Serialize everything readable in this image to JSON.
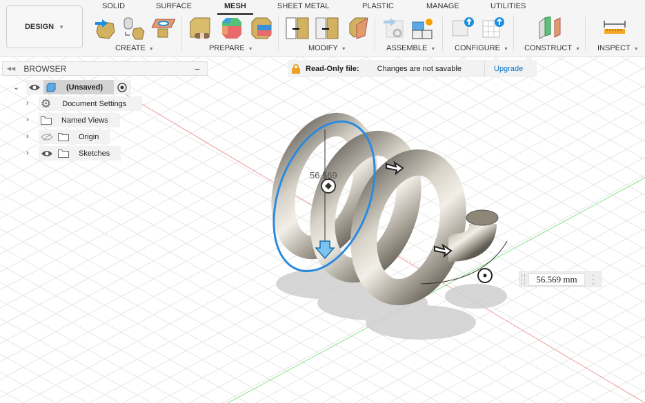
{
  "workspace": {
    "label": "DESIGN"
  },
  "tabs": [
    {
      "label": "SOLID"
    },
    {
      "label": "SURFACE"
    },
    {
      "label": "MESH",
      "active": true
    },
    {
      "label": "SHEET METAL"
    },
    {
      "label": "PLASTIC"
    },
    {
      "label": "MANAGE"
    },
    {
      "label": "UTILITIES"
    }
  ],
  "groups": [
    {
      "label": "CREATE"
    },
    {
      "label": "PREPARE"
    },
    {
      "label": "MODIFY"
    },
    {
      "label": "ASSEMBLE"
    },
    {
      "label": "CONFIGURE"
    },
    {
      "label": "CONSTRUCT"
    },
    {
      "label": "INSPECT"
    }
  ],
  "browser": {
    "title": "BROWSER",
    "root": "(Unsaved)",
    "items": [
      {
        "label": "Document Settings",
        "icon": "gear-icon"
      },
      {
        "label": "Named Views",
        "icon": "folder-icon"
      },
      {
        "label": "Origin",
        "icon": "folder-icon",
        "visible": false
      },
      {
        "label": "Sketches",
        "icon": "folder-icon",
        "visible": true
      }
    ]
  },
  "notice": {
    "title": "Read-Only file:",
    "message": "Changes are not savable",
    "action": "Upgrade"
  },
  "dimension": {
    "label": "56.569",
    "input": "56.569 mm"
  },
  "colors": {
    "accent": "#0696d7",
    "highlight": "#2a8ae0",
    "lock": "#f0a020",
    "x_axis": "#e88080",
    "y_axis": "#70d070"
  }
}
